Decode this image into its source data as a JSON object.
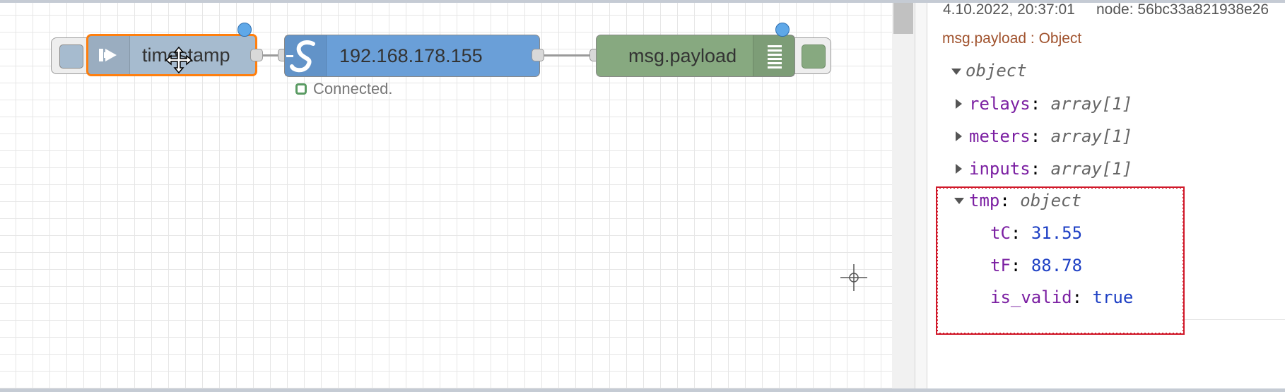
{
  "flow": {
    "inject_node": {
      "label": "timestamp",
      "icon": "arrow-right-icon"
    },
    "mqtt_node": {
      "label": "192.168.178.155",
      "status": "Connected.",
      "icon": "websocket-s-icon"
    },
    "debug_node": {
      "label": "msg.payload",
      "icon": "list-icon"
    }
  },
  "debug": {
    "timestamp": "4.10.2022, 20:37:01",
    "node": "node: 56bc33a821938e26",
    "topic_line": "msg.payload : Object",
    "root_type": "object",
    "entries": [
      {
        "key": "relays",
        "value": "array[1]"
      },
      {
        "key": "meters",
        "value": "array[1]"
      },
      {
        "key": "inputs",
        "value": "array[1]"
      }
    ],
    "tmp": {
      "key": "tmp",
      "type": "object",
      "fields": [
        {
          "key": "tC",
          "value": "31.55"
        },
        {
          "key": "tF",
          "value": "88.78"
        },
        {
          "key": "is_valid",
          "value": "true"
        }
      ]
    }
  },
  "colors": {
    "inject": "#a6bbcf",
    "mqtt": "#6a9fd8",
    "debug": "#87a980",
    "selected_outline": "#ff7f0e",
    "highlight": "#d0192a"
  }
}
